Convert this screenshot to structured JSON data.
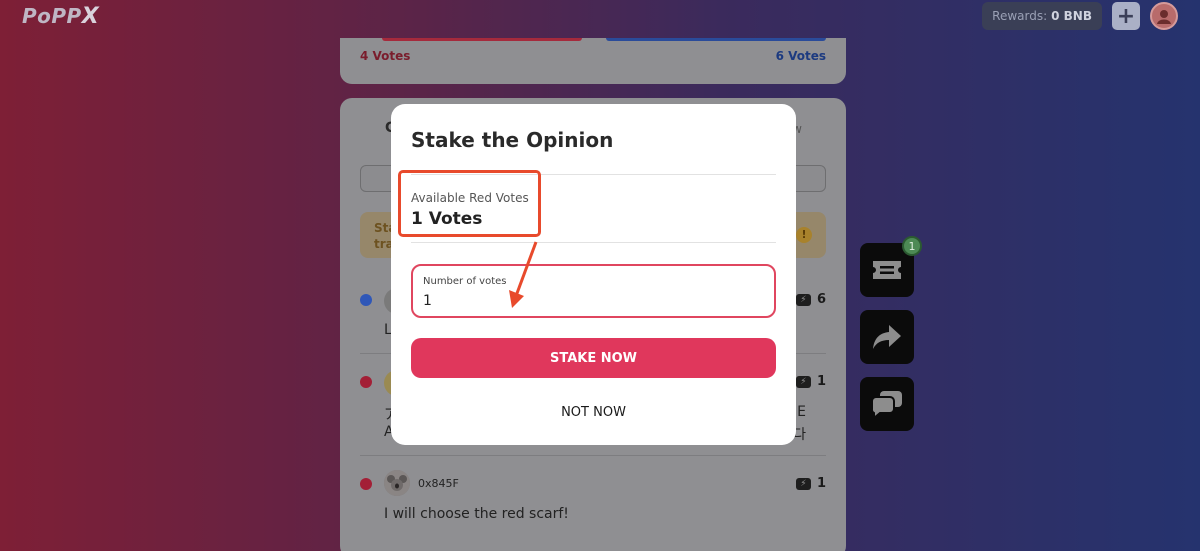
{
  "app": {
    "logo": "PoPP",
    "logo_x": "X"
  },
  "header": {
    "rewards_label": "Rewards:",
    "rewards_value": "0 BNB",
    "plus_label": "+"
  },
  "poll": {
    "red_votes": "4 Votes",
    "blue_votes": "6 Votes"
  },
  "feed": {
    "tab_left": "C",
    "tab_right": "w",
    "notice_text_line1": "Sta",
    "notice_text_line2": "tra",
    "notice_icon": "!",
    "comments": [
      {
        "dot_color": "#2f57b8",
        "stake": "6",
        "text": "L"
      },
      {
        "dot_color": "#a31f36",
        "stake": "1",
        "text_line1": "ア",
        "text_line2": "A",
        "text_right1": "E",
        "text_right2": "다"
      },
      {
        "dot_color": "#a31f36",
        "name": "0x845F",
        "stake": "1",
        "text": "I will choose the red scarf!"
      }
    ]
  },
  "side": {
    "badge": "1"
  },
  "modal": {
    "title": "Stake the Opinion",
    "available_label": "Available Red Votes",
    "available_value": "1 Votes",
    "input_label": "Number of votes",
    "input_value": "1",
    "stake_button": "STAKE NOW",
    "not_now_button": "NOT NOW"
  },
  "colors": {
    "accent": "#e0375c",
    "highlight": "#e84a2c",
    "red_team": "#a31f36",
    "blue_team": "#2f57b8"
  }
}
